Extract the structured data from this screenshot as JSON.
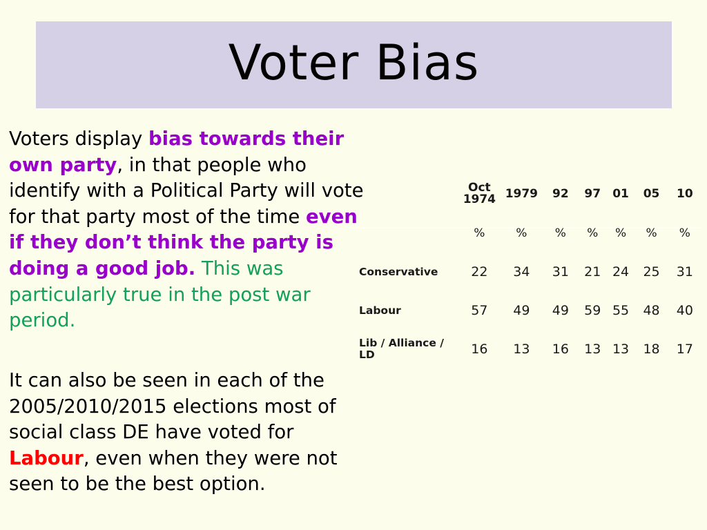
{
  "slide": {
    "title": "Voter Bias",
    "background_color": "#fdfdec",
    "title_band_color": "#d5d0e5",
    "accent_colors": {
      "purple": "#9900cc",
      "green": "#13a05a",
      "red": "#ff0000",
      "black": "#000000"
    }
  },
  "paragraph_one": {
    "segment_1_black": "Voters display ",
    "segment_2_purple": "bias towards their own party",
    "segment_3_black": ", in that people who identify with a Political Party will vote for that party most of the time ",
    "segment_4_purple": "even if they don’t think the party is doing a good job.",
    "segment_5_green": " This was particularly true in the post war period."
  },
  "paragraph_two": {
    "segment_1_black": " It can also be seen in each of the 2005/2010/2015 elections most of social class DE have voted for ",
    "segment_2_red": "Labour",
    "segment_3_black": ", even when they were not seen to be the best option."
  },
  "table": {
    "corner_label": "",
    "columns": [
      "Oct 1974",
      "1979",
      "92",
      "97",
      "01",
      "05",
      "10"
    ],
    "column_header_lines": [
      [
        "Oct",
        "1974"
      ],
      [
        "1979"
      ],
      [
        "92"
      ],
      [
        "97"
      ],
      [
        "01"
      ],
      [
        "05"
      ],
      [
        "10"
      ]
    ],
    "unit_row_label": "",
    "unit_row": [
      "%",
      "%",
      "%",
      "%",
      "%",
      "%",
      "%"
    ],
    "rows": [
      {
        "label": "Conservative",
        "values": [
          "22",
          "34",
          "31",
          "21",
          "24",
          "25",
          "31"
        ]
      },
      {
        "label": "Labour",
        "values": [
          "57",
          "49",
          "49",
          "59",
          "55",
          "48",
          "40"
        ]
      },
      {
        "label": "Lib / Alliance / LD",
        "values": [
          "16",
          "13",
          "16",
          "13",
          "13",
          "18",
          "17"
        ]
      }
    ]
  }
}
